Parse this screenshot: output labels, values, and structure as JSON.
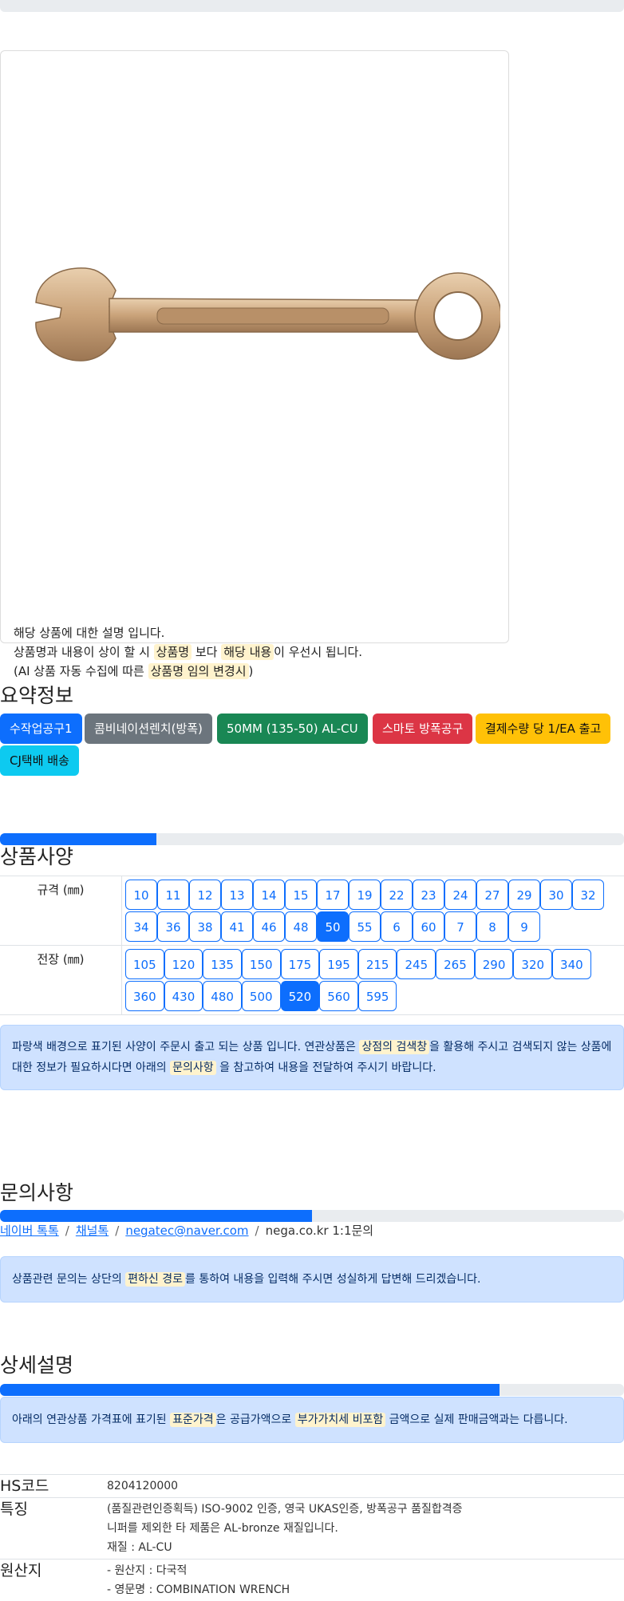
{
  "product": {
    "desc_line1": "해당 상품에 대한 설명 입니다.",
    "desc_line2_a": "상품명과 내용이 상이 할 시 ",
    "desc_line2_hl1": "상품명",
    "desc_line2_b": " 보다 ",
    "desc_line2_hl2": "해당 내용",
    "desc_line2_c": "이 우선시 됩니다.",
    "desc_line3_a": "(AI 상품 자동 수집에 따른 ",
    "desc_line3_hl": "상품명 임의 변경시",
    "desc_line3_b": ")"
  },
  "summary": {
    "title": "요약정보",
    "badges": [
      {
        "label": "수작업공구1",
        "color": "#0d6efd"
      },
      {
        "label": "콤비네이션렌치(방폭)",
        "color": "#6c757d"
      },
      {
        "label": "50MM (135-50) AL-CU",
        "color": "#198754"
      },
      {
        "label": "스마토 방폭공구",
        "color": "#dc3545"
      },
      {
        "label": "결제수량 당 1/EA 출고",
        "color": "#ffc107"
      },
      {
        "label": "CJ택배 배송",
        "color": "#0dcaf0"
      }
    ]
  },
  "spec": {
    "progress_pct": 25,
    "title": "상품사양",
    "size_label": "규격 (㎜)",
    "size_options": [
      "10",
      "11",
      "12",
      "13",
      "14",
      "15",
      "17",
      "19",
      "22",
      "23",
      "24",
      "27",
      "29",
      "30",
      "32",
      "34",
      "36",
      "38",
      "41",
      "46",
      "48",
      "50",
      "55",
      "6",
      "60",
      "7",
      "8",
      "9"
    ],
    "size_selected": "50",
    "length_label": "전장 (㎜)",
    "length_options": [
      "105",
      "120",
      "135",
      "150",
      "175",
      "195",
      "215",
      "245",
      "265",
      "290",
      "320",
      "340",
      "360",
      "430",
      "480",
      "500",
      "520",
      "560",
      "595"
    ],
    "length_selected": "520",
    "notice_a": "파랑색 배경으로 표기된 사양이 주문시 출고 되는 상품 입니다. 연관상품은 ",
    "notice_hl1": "상점의 검색창",
    "notice_b": "을 활용해 주시고 검색되지 않는 상품에 대한 정보가 필요하시다면 아래의 ",
    "notice_hl2": "문의사항",
    "notice_c": " 을 참고하여 내용을 전달하여 주시기 바랍니다."
  },
  "inquiry": {
    "title": "문의사항",
    "progress_pct": 50,
    "link1": "네이버 톡톡",
    "link2": "채널톡",
    "link3": "negatec@naver.com",
    "text4": "nega.co.kr 1:1문의",
    "notice_a": "상품관련 문의는 상단의 ",
    "notice_hl": "편하신 경로",
    "notice_b": "를 통하여 내용을 입력해 주시면 성실하게 답변해 드리겠습니다."
  },
  "detail": {
    "title": "상세설명",
    "progress_pct": 80,
    "notice_a": "아래의 연관상품 가격표에 표기된 ",
    "notice_hl1": "표준가격",
    "notice_b": "은 공급가액으로 ",
    "notice_hl2": "부가가치세 비포함",
    "notice_c": " 금액으로 실제 판매금액과는 다릅니다.",
    "hs_key": "HS코드",
    "hs_value": "8204120000",
    "feature_key": "특징",
    "feature_line1": "(품질관련인증획득) ISO-9002 인증, 영국 UKAS인증, 방폭공구 품질합격증",
    "feature_line2": "니퍼를 제외한 타 제품은 AL-bronze 재질입니다.",
    "feature_line3": "재질 : AL-CU",
    "origin_key": "원산지",
    "origin_line1": "- 원산지 : 다국적",
    "origin_line2": "- 영문명 : COMBINATION WRENCH"
  }
}
